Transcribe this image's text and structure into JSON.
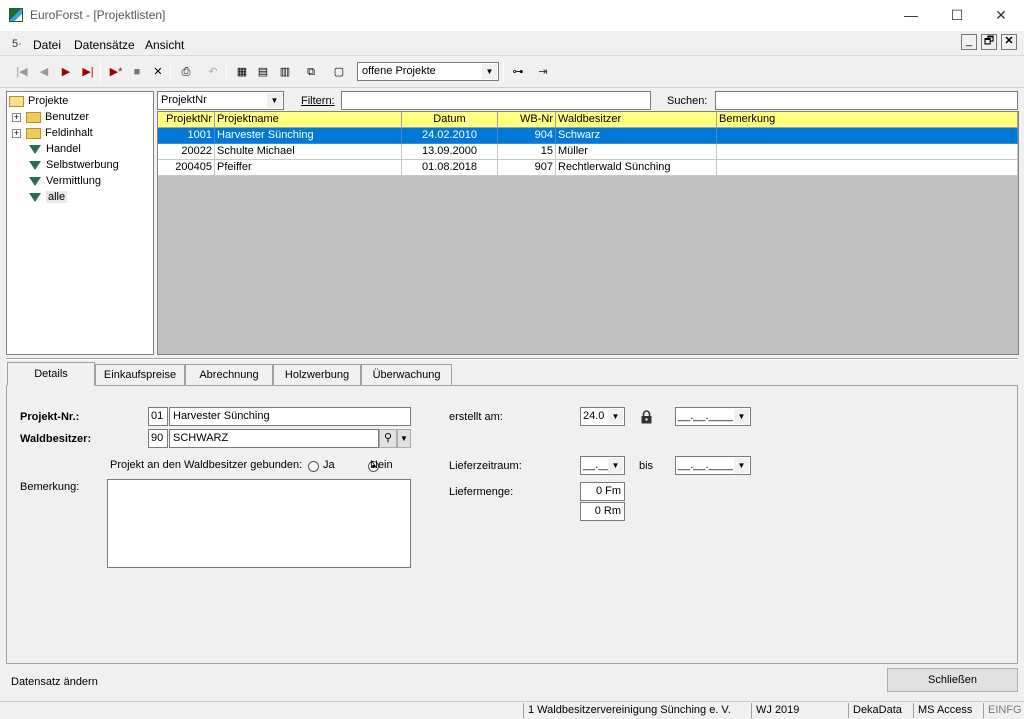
{
  "window": {
    "title": "EuroForst - [Projektlisten]",
    "minimize": "—",
    "maximize": "☐",
    "close": "✕"
  },
  "menu": {
    "items": [
      "Datei",
      "Datensätze",
      "Ansicht"
    ],
    "mdi_min": "_",
    "mdi_restore": "🗗",
    "mdi_close": "✕"
  },
  "toolbar": {
    "view_combo": "offene Projekte"
  },
  "tree": {
    "items": [
      {
        "label": "Projekte",
        "kind": "folder-open"
      },
      {
        "label": "Benutzer",
        "kind": "folder",
        "expandable": true
      },
      {
        "label": "Feldinhalt",
        "kind": "folder",
        "expandable": true
      },
      {
        "label": "Handel",
        "kind": "filter"
      },
      {
        "label": "Selbstwerbung",
        "kind": "filter"
      },
      {
        "label": "Vermittlung",
        "kind": "filter"
      },
      {
        "label": "alle",
        "kind": "filter"
      }
    ]
  },
  "filterbar": {
    "sort_field": "ProjektNr",
    "filter_label": "Filtern:",
    "filter_value": "",
    "search_label": "Suchen:",
    "search_value": ""
  },
  "grid": {
    "columns": [
      "ProjektNr",
      "Projektname",
      "Datum",
      "WB-Nr",
      "Waldbesitzer",
      "Bemerkung"
    ],
    "rows": [
      {
        "nr": "1001",
        "name": "Harvester Sünching",
        "datum": "24.02.2010",
        "wbnr": "904",
        "besitzer": "Schwarz",
        "bemerkung": "",
        "selected": true
      },
      {
        "nr": "20022",
        "name": "Schulte Michael",
        "datum": "13.09.2000",
        "wbnr": "15",
        "besitzer": "Müller",
        "bemerkung": ""
      },
      {
        "nr": "200405",
        "name": "Pfeiffer",
        "datum": "01.08.2018",
        "wbnr": "907",
        "besitzer": "Rechtlerwald Sünching",
        "bemerkung": ""
      }
    ]
  },
  "tabs": [
    "Details",
    "Einkaufspreise",
    "Abrechnung",
    "Holzwerbung",
    "Überwachung"
  ],
  "details": {
    "projekt_nr_label": "Projekt-Nr.:",
    "projekt_nr_code": "01",
    "projekt_name": "Harvester Sünching",
    "waldbesitzer_label": "Waldbesitzer:",
    "waldbesitzer_code": "90",
    "waldbesitzer_name": "SCHWARZ",
    "gebunden_label": "Projekt an den Waldbesitzer gebunden:",
    "ja_label": "Ja",
    "nein_label": "Nein",
    "bemerkung_label": "Bemerkung:",
    "bemerkung_value": "",
    "erstellt_label": "erstellt am:",
    "erstellt_value": "24.0",
    "erstellt_date2": "__.__.____",
    "lieferzeitraum_label": "Lieferzeitraum:",
    "liefer_von": "__.__",
    "bis_label": "bis",
    "liefer_bis": "__.__.____",
    "liefermenge_label": "Liefermenge:",
    "menge_fm": "0 Fm",
    "menge_rm": "0 Rm"
  },
  "footer": {
    "status_text": "Datensatz ändern",
    "close_button": "Schließen"
  },
  "statusbar": {
    "org": "1 Waldbesitzervereinigung Sünching e. V.",
    "wj": "WJ 2019",
    "user": "DekaData",
    "db": "MS Access",
    "mode": "EINFG"
  }
}
